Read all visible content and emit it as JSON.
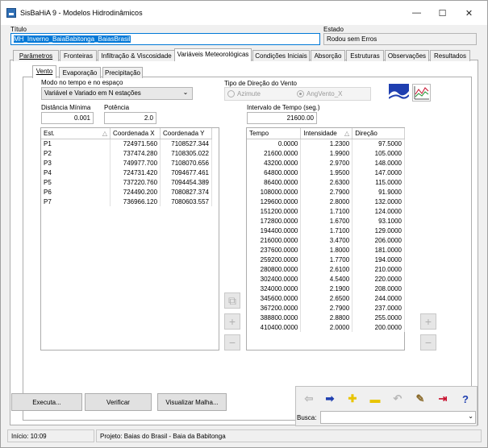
{
  "window": {
    "title": "SisBaHiA 9 - Modelos Hidrodinâmicos",
    "minimize": "—",
    "maximize": "☐",
    "close": "✕"
  },
  "header": {
    "titulo_label": "Título",
    "titulo_value": "MH_Inverno_BaiaBabitonga_BaiasBrasil",
    "estado_label": "Estado",
    "estado_value": "Rodou sem Erros"
  },
  "tabs": [
    "Parâmetros",
    "Fronteiras",
    "Infiltração & Viscosidade",
    "Variáveis Meteorológicas",
    "Condições Iniciais",
    "Absorção",
    "Estruturas",
    "Observações",
    "Resultados"
  ],
  "subtabs": [
    "Vento",
    "Evaporação",
    "Precipitação"
  ],
  "vento": {
    "modo_label": "Modo no tempo e no espaço",
    "modo_value": "Variável e Variado em N estações",
    "tipo_label": "Tipo de Direção do Vento",
    "radio_azimute": "Azimute",
    "radio_angvento": "AngVento_X",
    "dist_label": "Distância Mínima",
    "dist_value": "0.001",
    "pot_label": "Potência",
    "pot_value": "2.0",
    "intervalo_label": "Intervalo de Tempo (seg.)",
    "intervalo_value": "21600.00"
  },
  "stations": {
    "headers": [
      "Est.",
      "Coordenada X",
      "Coordenada Y"
    ],
    "sort_glyph": "△",
    "rows": [
      [
        "P1",
        "724971.560",
        "7108527.344"
      ],
      [
        "P2",
        "737474.280",
        "7108305.022"
      ],
      [
        "P3",
        "749977.700",
        "7108070.656"
      ],
      [
        "P4",
        "724731.420",
        "7094677.461"
      ],
      [
        "P5",
        "737220.760",
        "7094454.389"
      ],
      [
        "P6",
        "724490.200",
        "7080827.374"
      ],
      [
        "P7",
        "736966.120",
        "7080603.557"
      ]
    ]
  },
  "series": {
    "headers": [
      "Tempo",
      "Intensidade",
      "Direção"
    ],
    "sort_glyph": "△",
    "rows": [
      [
        "0.0000",
        "1.2300",
        "97.5000"
      ],
      [
        "21600.0000",
        "1.9900",
        "105.0000"
      ],
      [
        "43200.0000",
        "2.9700",
        "148.0000"
      ],
      [
        "64800.0000",
        "1.9500",
        "147.0000"
      ],
      [
        "86400.0000",
        "2.6300",
        "115.0000"
      ],
      [
        "108000.0000",
        "2.7900",
        "91.9000"
      ],
      [
        "129600.0000",
        "2.8000",
        "132.0000"
      ],
      [
        "151200.0000",
        "1.7100",
        "124.0000"
      ],
      [
        "172800.0000",
        "1.6700",
        "93.1000"
      ],
      [
        "194400.0000",
        "1.7100",
        "129.0000"
      ],
      [
        "216000.0000",
        "3.4700",
        "206.0000"
      ],
      [
        "237600.0000",
        "1.8000",
        "181.0000"
      ],
      [
        "259200.0000",
        "1.7700",
        "194.0000"
      ],
      [
        "280800.0000",
        "2.6100",
        "210.0000"
      ],
      [
        "302400.0000",
        "4.5400",
        "220.0000"
      ],
      [
        "324000.0000",
        "2.1900",
        "208.0000"
      ],
      [
        "345600.0000",
        "2.6500",
        "244.0000"
      ],
      [
        "367200.0000",
        "2.7900",
        "237.0000"
      ],
      [
        "388800.0000",
        "2.8800",
        "255.0000"
      ],
      [
        "410400.0000",
        "2.0000",
        "200.0000"
      ]
    ]
  },
  "buttons": {
    "executa": "Executa...",
    "verificar": "Verificar",
    "visualizar": "Visualizar Malha..."
  },
  "toolbar": {
    "busca_label": "Busca:",
    "busca_value": ""
  },
  "statusbar": {
    "inicio": "Início: 10:09",
    "projeto": "Projeto: Baias do Brasil - Baia da Babitonga"
  },
  "colors": {
    "accent": "#0078d7",
    "tool_blue": "#1f3fb0",
    "tool_yellow": "#e8c400",
    "tool_red": "#c8102e"
  }
}
